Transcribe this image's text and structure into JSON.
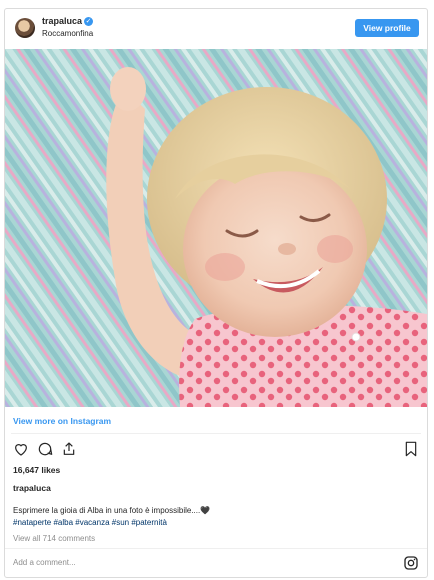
{
  "header": {
    "username": "trapaluca",
    "location": "Roccamonfina",
    "verified_icon": "verified-badge-icon",
    "view_profile_label": "View profile"
  },
  "photo": {
    "subject": "smiling-child-on-striped-blanket"
  },
  "post": {
    "view_more_label": "View more on Instagram",
    "likes": "16,647 likes",
    "author": "trapaluca",
    "caption": "Esprimere la gioia di Alba in una foto è impossibile....🖤",
    "hashtags": "#nataperte #alba #vacanza #sun #paternità",
    "comments_link": "View all 714 comments",
    "add_comment_placeholder": "Add a comment...",
    "icons": [
      "heart-icon",
      "comment-icon",
      "share-icon",
      "bookmark-icon",
      "instagram-logo-icon"
    ]
  },
  "colors": {
    "accent": "#3897f0",
    "hashtag": "#003569",
    "muted": "#8e8e8e"
  }
}
